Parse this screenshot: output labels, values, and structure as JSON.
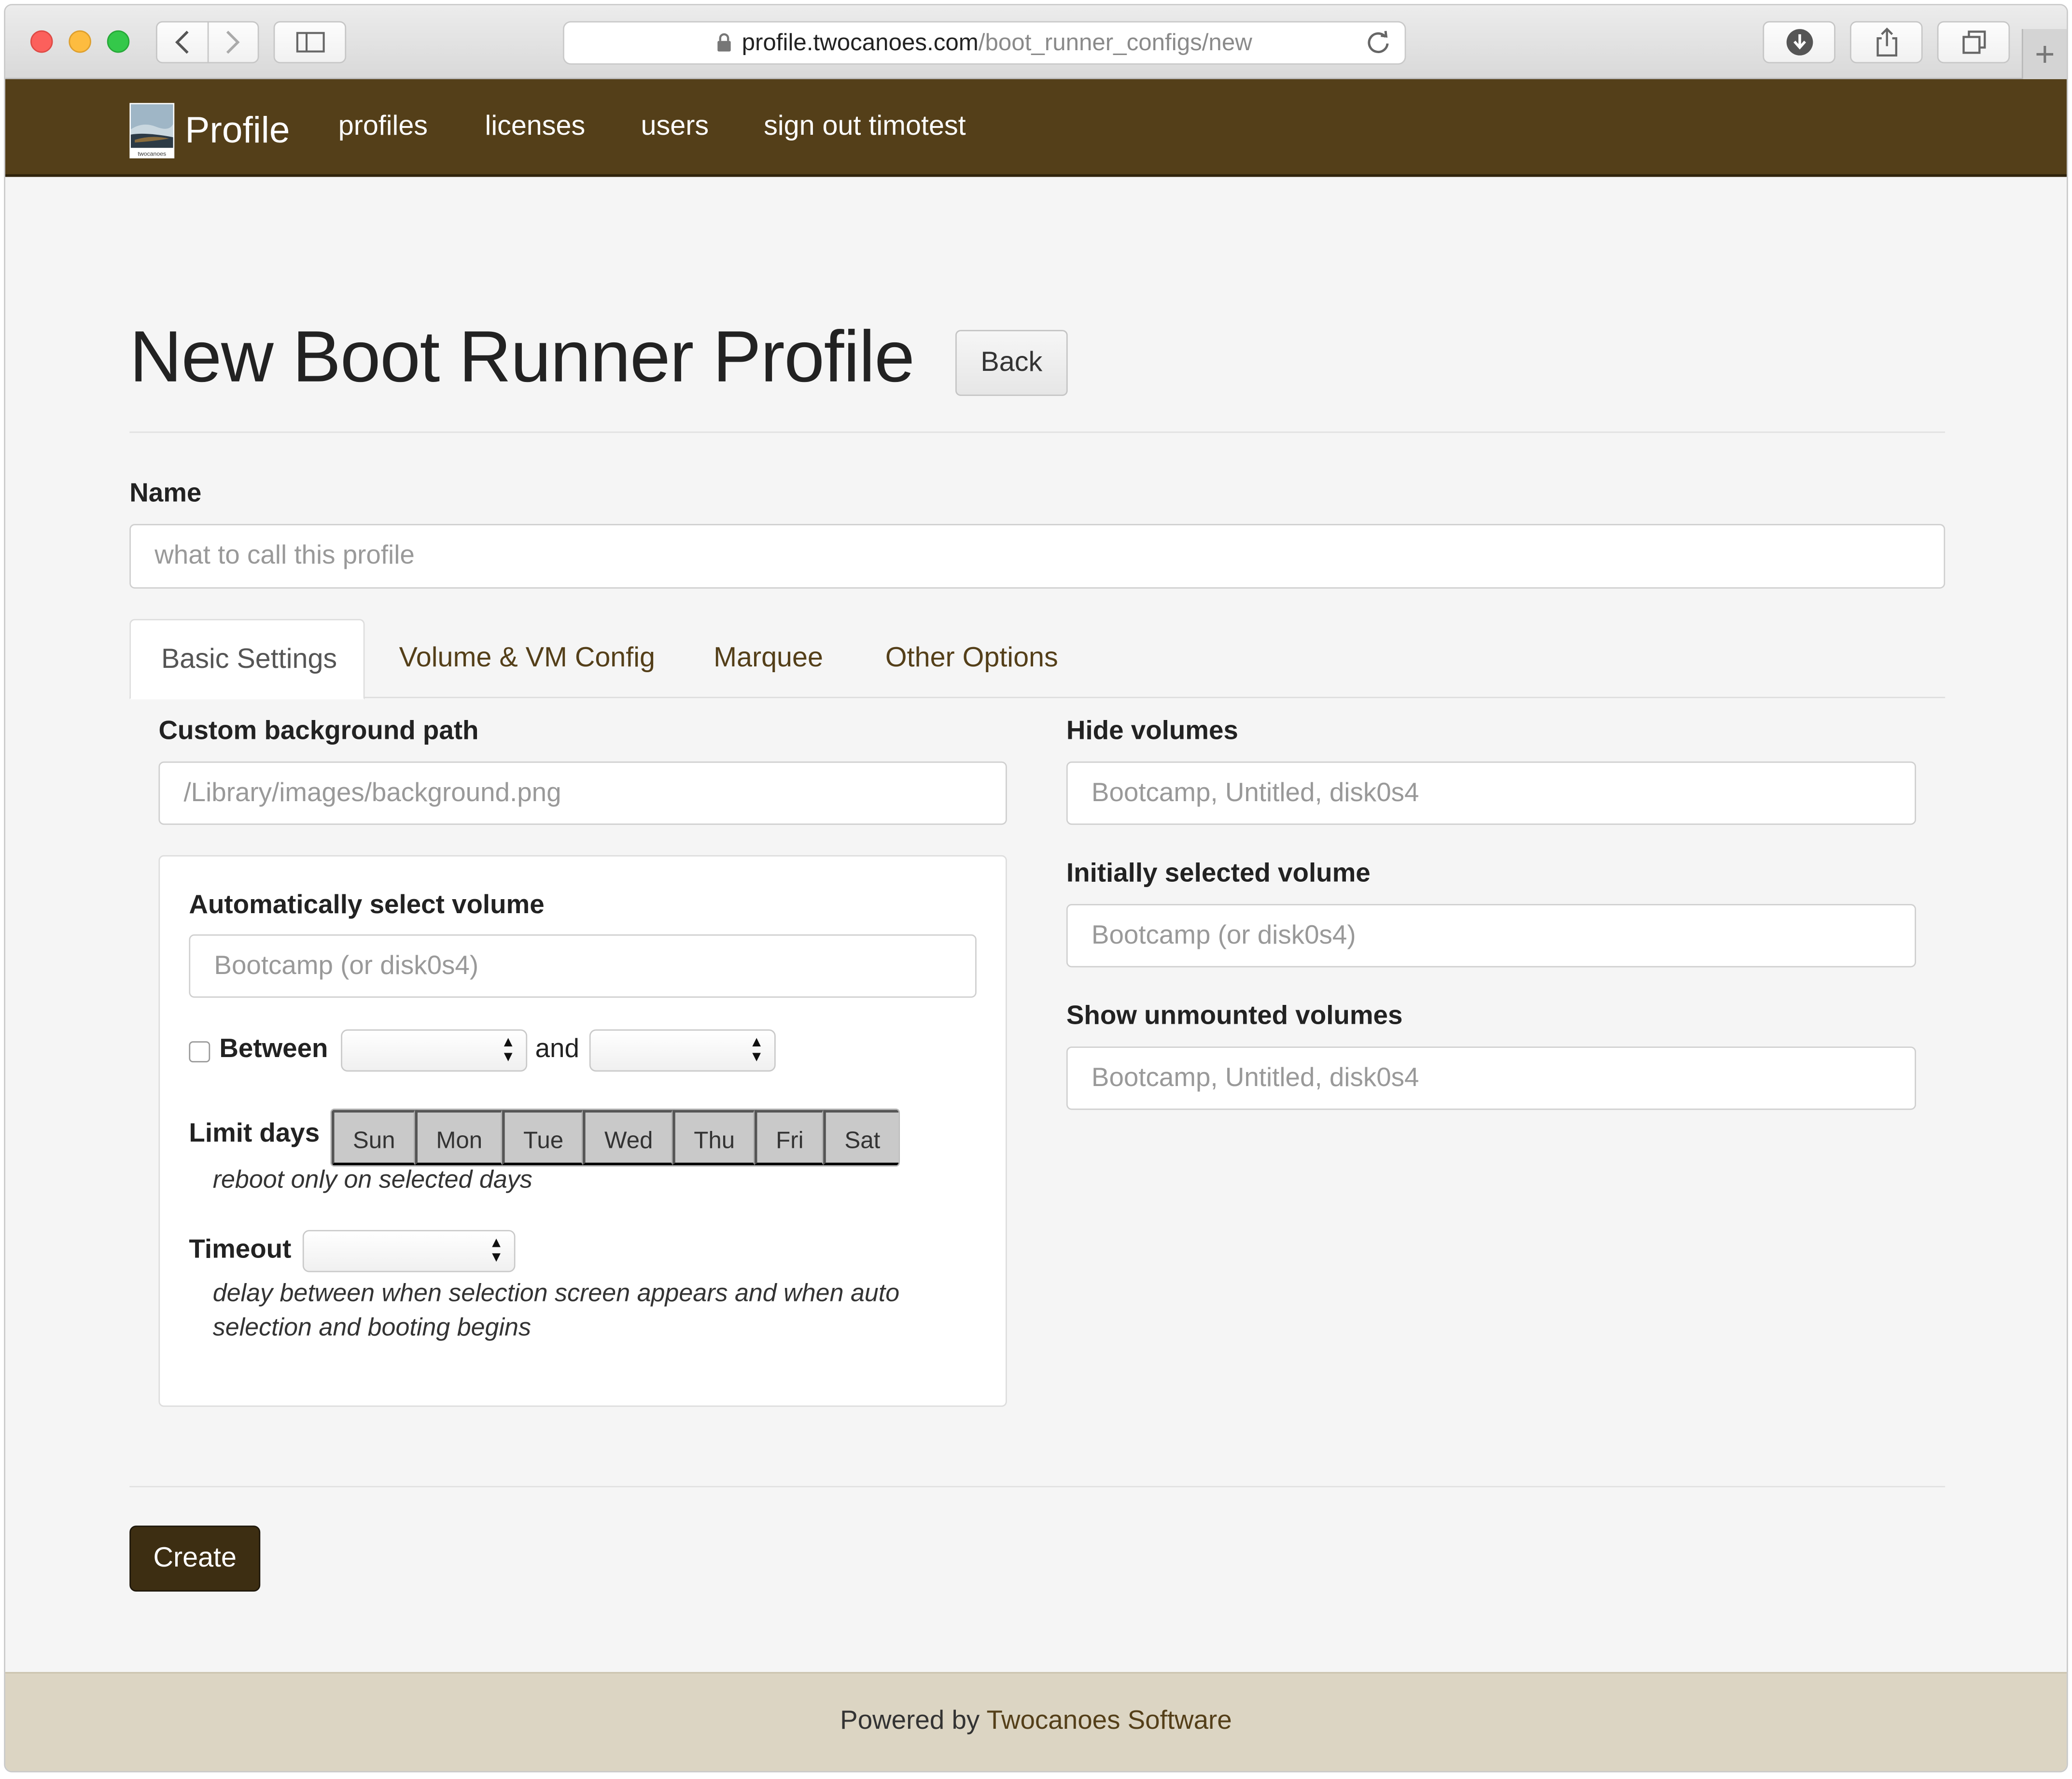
{
  "browser": {
    "url_host": "profile.twocanoes.com",
    "url_path": "/boot_runner_configs/new"
  },
  "navbar": {
    "brand": "Profile",
    "logo_caption": "twocanoes",
    "links": [
      "profiles",
      "licenses",
      "users",
      "sign out timotest"
    ]
  },
  "page": {
    "title": "New Boot Runner Profile",
    "back_label": "Back"
  },
  "name_field": {
    "label": "Name",
    "placeholder": "what to call this profile"
  },
  "tabs": [
    "Basic Settings",
    "Volume & VM Config",
    "Marquee",
    "Other Options"
  ],
  "basic": {
    "custom_bg": {
      "label": "Custom background path",
      "placeholder": "/Library/images/background.png"
    },
    "auto_select": {
      "label": "Automatically select volume",
      "placeholder": "Bootcamp (or disk0s4)",
      "between_label": "Between",
      "and_label": "and",
      "limit_days_label": "Limit days",
      "days": [
        "Sun",
        "Mon",
        "Tue",
        "Wed",
        "Thu",
        "Fri",
        "Sat"
      ],
      "limit_days_help": "reboot only on selected days",
      "timeout_label": "Timeout",
      "timeout_help": "delay between when selection screen appears and when auto selection and booting begins"
    },
    "hide_volumes": {
      "label": "Hide volumes",
      "placeholder": "Bootcamp, Untitled, disk0s4"
    },
    "initial_volume": {
      "label": "Initially selected volume",
      "placeholder": "Bootcamp (or disk0s4)"
    },
    "show_unmounted": {
      "label": "Show unmounted volumes",
      "placeholder": "Bootcamp, Untitled, disk0s4"
    }
  },
  "create_label": "Create",
  "footer": {
    "prefix": "Powered by",
    "link": "Twocanoes Software"
  },
  "colors": {
    "navbar": "#543f19",
    "accent": "#543f19",
    "footer": "#dcd5c3",
    "create_button": "#3d2e12"
  }
}
